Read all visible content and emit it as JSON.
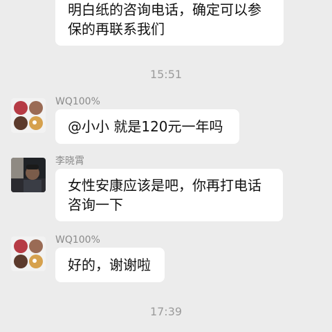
{
  "chat": {
    "messages": [
      {
        "id": "m1",
        "lines": [
          "明白纸的咨询电话，确定可以参",
          "保的再联系我们"
        ]
      },
      {
        "id": "m2",
        "sender": "WQ100%",
        "lines": [
          "@小小 就是120元一年吗"
        ],
        "avatar": "food-collage-avatar"
      },
      {
        "id": "m3",
        "sender": "李晓霄",
        "lines": [
          "女性安康应该是吧，你再打电话",
          "咨询一下"
        ],
        "avatar": "person-photo-avatar"
      },
      {
        "id": "m4",
        "sender": "WQ100%",
        "lines": [
          "好的，谢谢啦"
        ],
        "avatar": "food-collage-avatar"
      }
    ],
    "timestamps": [
      "15:51",
      "17:39"
    ]
  },
  "colors": {
    "background": "#ececec",
    "bubble": "#ffffff",
    "timestamp": "#9b9b9b",
    "sender_name": "#8a8a8a"
  }
}
